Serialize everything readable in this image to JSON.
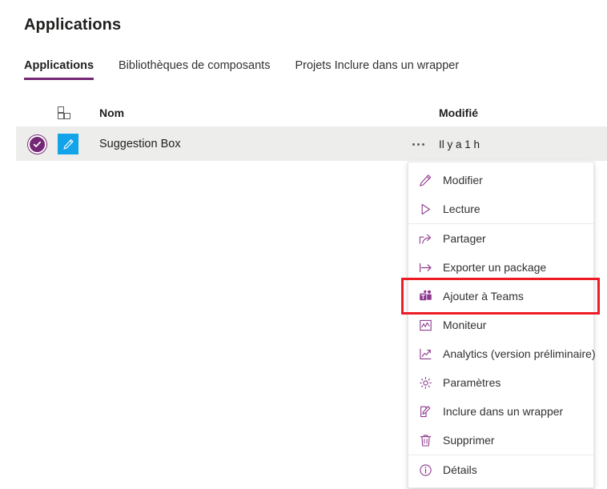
{
  "page": {
    "title": "Applications"
  },
  "tabs": [
    {
      "label": "Applications",
      "active": true
    },
    {
      "label": "Bibliothèques de composants",
      "active": false
    },
    {
      "label": "Projets Inclure dans un wrapper",
      "active": false
    }
  ],
  "grid": {
    "columns": {
      "icon_header": "grid-layout-icon",
      "name": "Nom",
      "modified": "Modifié"
    },
    "rows": [
      {
        "selected": true,
        "name": "Suggestion Box",
        "modified": "Il y a 1 h",
        "app_icon": "pencil-icon",
        "check_icon": "checkmark-circle-icon",
        "overflow": "ellipsis-icon"
      }
    ]
  },
  "context_menu": {
    "items": [
      {
        "label": "Modifier",
        "icon": "pencil-icon",
        "divider_after": false,
        "highlighted": false
      },
      {
        "label": "Lecture",
        "icon": "play-triangle-icon",
        "divider_after": true,
        "highlighted": false
      },
      {
        "label": "Partager",
        "icon": "share-icon",
        "divider_after": false,
        "highlighted": false
      },
      {
        "label": "Exporter un package",
        "icon": "export-arrow-icon",
        "divider_after": false,
        "highlighted": false
      },
      {
        "label": "Ajouter à Teams",
        "icon": "teams-icon",
        "divider_after": false,
        "highlighted": true
      },
      {
        "label": "Moniteur",
        "icon": "monitor-chart-icon",
        "divider_after": false,
        "highlighted": false
      },
      {
        "label": "Analytics (version préliminaire)",
        "icon": "analytics-trend-icon",
        "divider_after": false,
        "highlighted": false
      },
      {
        "label": "Paramètres",
        "icon": "gear-icon",
        "divider_after": false,
        "highlighted": false
      },
      {
        "label": "Inclure dans un wrapper",
        "icon": "wrapper-edit-icon",
        "divider_after": false,
        "highlighted": false
      },
      {
        "label": "Supprimer",
        "icon": "trash-icon",
        "divider_after": true,
        "highlighted": false
      },
      {
        "label": "Détails",
        "icon": "info-circle-icon",
        "divider_after": false,
        "highlighted": false
      }
    ]
  },
  "colors": {
    "accent_purple": "#742774",
    "icon_purple": "#8e3a8e",
    "app_icon_blue": "#13a3e8",
    "row_selected_bg": "#ededeb",
    "highlight_red": "#ed1c24"
  }
}
